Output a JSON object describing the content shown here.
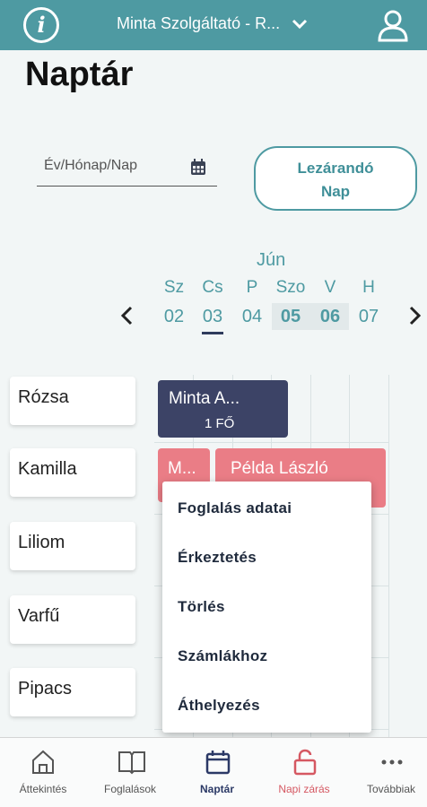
{
  "header": {
    "provider_name": "Minta Szolgáltató - R..."
  },
  "page": {
    "title": "Naptár"
  },
  "date_input": {
    "placeholder": "Év/Hónap/Nap"
  },
  "close_day_button": {
    "line1": "Lezárandó",
    "line2": "Nap"
  },
  "week": {
    "month": "Jún",
    "days": [
      {
        "name": "Sz",
        "date": "02"
      },
      {
        "name": "Cs",
        "date": "03"
      },
      {
        "name": "P",
        "date": "04"
      },
      {
        "name": "Szo",
        "date": "05"
      },
      {
        "name": "V",
        "date": "06"
      },
      {
        "name": "H",
        "date": "07"
      }
    ]
  },
  "rooms": [
    "Rózsa",
    "Kamilla",
    "Liliom",
    "Varfű",
    "Pipacs"
  ],
  "bookings": [
    {
      "name": "Minta A...",
      "count": "1 FŐ"
    },
    {
      "name": "M..."
    },
    {
      "name": "Példa László"
    }
  ],
  "context_menu": {
    "items": [
      "Foglalás adatai",
      "Érkeztetés",
      "Törlés",
      "Számlákhoz",
      "Áthelyezés"
    ]
  },
  "bottom_nav": {
    "items": [
      {
        "label": "Áttekintés",
        "icon": "home-icon"
      },
      {
        "label": "Foglalások",
        "icon": "book-icon"
      },
      {
        "label": "Naptár",
        "icon": "calendar-icon"
      },
      {
        "label": "Napi zárás",
        "icon": "unlock-icon"
      },
      {
        "label": "Továbbiak",
        "icon": "more-icon"
      }
    ]
  },
  "colors": {
    "accent": "#4e9aa2",
    "dark_booking": "#3c4366",
    "pink_booking": "#ea7d86",
    "active_nav": "#2b3966",
    "warn_nav": "#d55862"
  }
}
